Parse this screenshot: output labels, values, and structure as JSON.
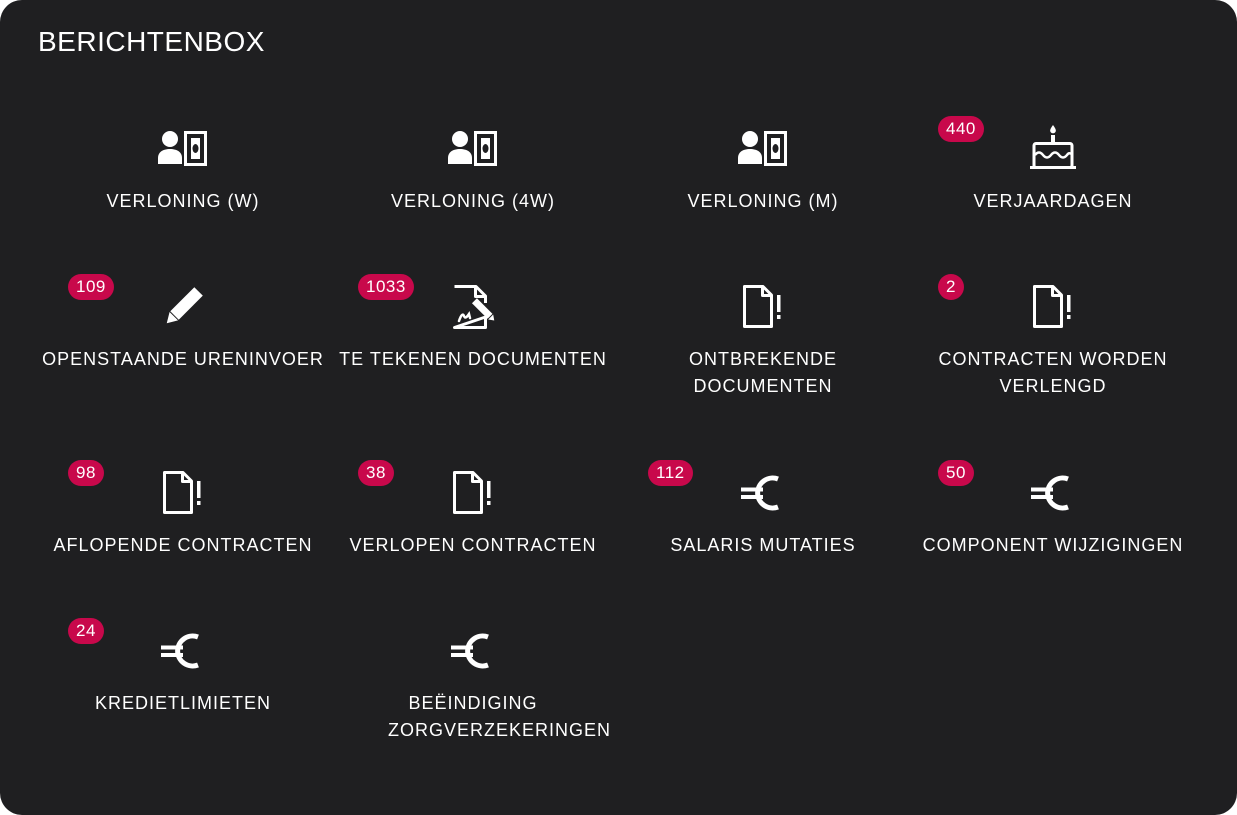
{
  "title": "BERICHTENBOX",
  "colors": {
    "panel_background": "#1f1f21",
    "text": "#ffffff",
    "badge": "#c8084b"
  },
  "tiles": [
    {
      "label": "VERLONING (W)",
      "icon": "payroll-person-icon",
      "badge": ""
    },
    {
      "label": "VERLONING (4W)",
      "icon": "payroll-person-icon",
      "badge": ""
    },
    {
      "label": "VERLONING (M)",
      "icon": "payroll-person-icon",
      "badge": ""
    },
    {
      "label": "VERJAARDAGEN",
      "icon": "birthday-cake-icon",
      "badge": "440"
    },
    {
      "label": "OPENSTAANDE URENINVOER",
      "icon": "pencil-icon",
      "badge": "109"
    },
    {
      "label": "TE TEKENEN DOCUMENTEN",
      "icon": "document-sign-icon",
      "badge": "1033"
    },
    {
      "label": "ONTBREKENDE DOCUMENTEN",
      "icon": "document-alert-icon",
      "badge": ""
    },
    {
      "label": "CONTRACTEN WORDEN VERLENGD",
      "icon": "document-alert-icon",
      "badge": "2"
    },
    {
      "label": "AFLOPENDE CONTRACTEN",
      "icon": "document-alert-icon",
      "badge": "98"
    },
    {
      "label": "VERLOPEN CONTRACTEN",
      "icon": "document-alert-icon",
      "badge": "38"
    },
    {
      "label": "SALARIS MUTATIES",
      "icon": "euro-icon",
      "badge": "112"
    },
    {
      "label": "COMPONENT WIJZIGINGEN",
      "icon": "euro-icon",
      "badge": "50"
    },
    {
      "label": "KREDIETLIMIETEN",
      "icon": "euro-icon",
      "badge": "24"
    },
    {
      "label": "BEËINDIGING ZORGVERZEKERINGEN",
      "icon": "euro-icon",
      "badge": ""
    }
  ]
}
